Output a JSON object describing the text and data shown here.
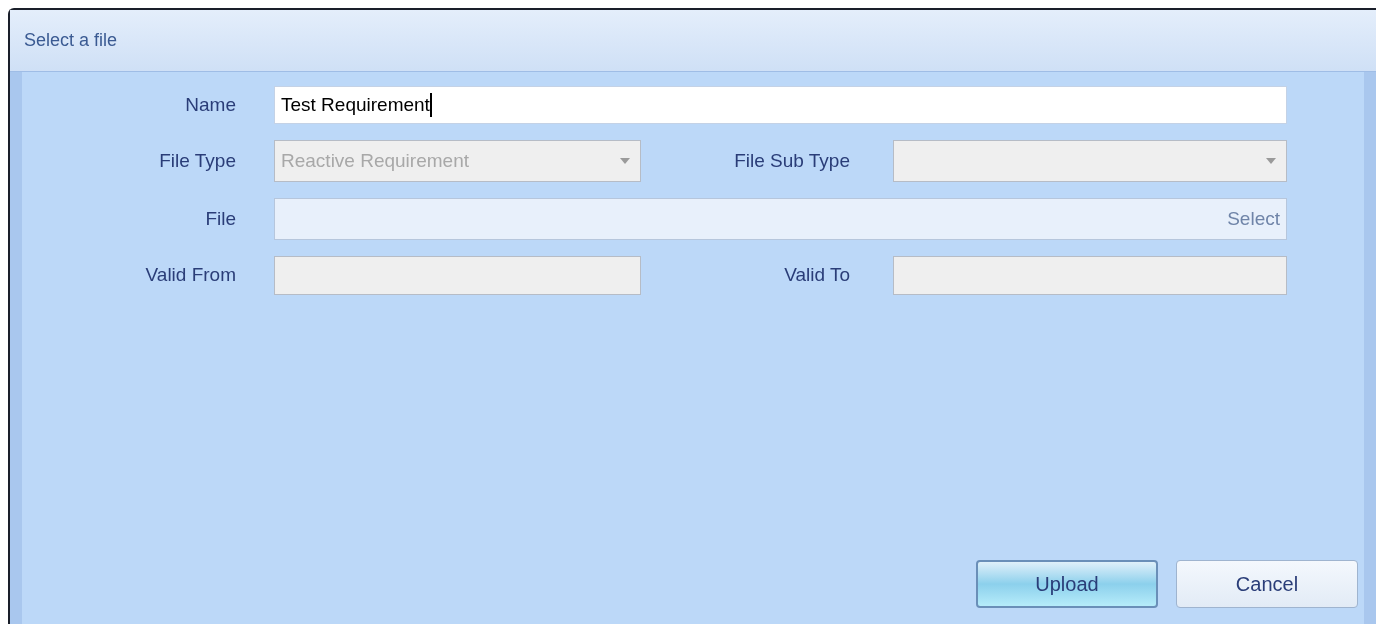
{
  "window": {
    "title": "Select a file"
  },
  "rows": [
    [
      {
        "label": "Name",
        "kind": "text",
        "value": "Test Requirement",
        "focused": true,
        "disabled": false
      }
    ],
    [
      {
        "label": "File Type",
        "kind": "dropdown",
        "value": "Reactive Requirement",
        "disabled": true
      },
      {
        "label": "File Sub Type",
        "kind": "dropdown",
        "disabled": true
      }
    ],
    [
      {
        "label": "File",
        "kind": "file",
        "action": "Select",
        "disabled": false
      }
    ],
    [
      {
        "label": "Valid From",
        "kind": "text",
        "disabled": true
      },
      {
        "label": "Valid To",
        "kind": "text",
        "disabled": true
      }
    ]
  ],
  "buttons": [
    {
      "label": "Upload",
      "default": true
    },
    {
      "label": "Cancel",
      "default": false
    }
  ]
}
